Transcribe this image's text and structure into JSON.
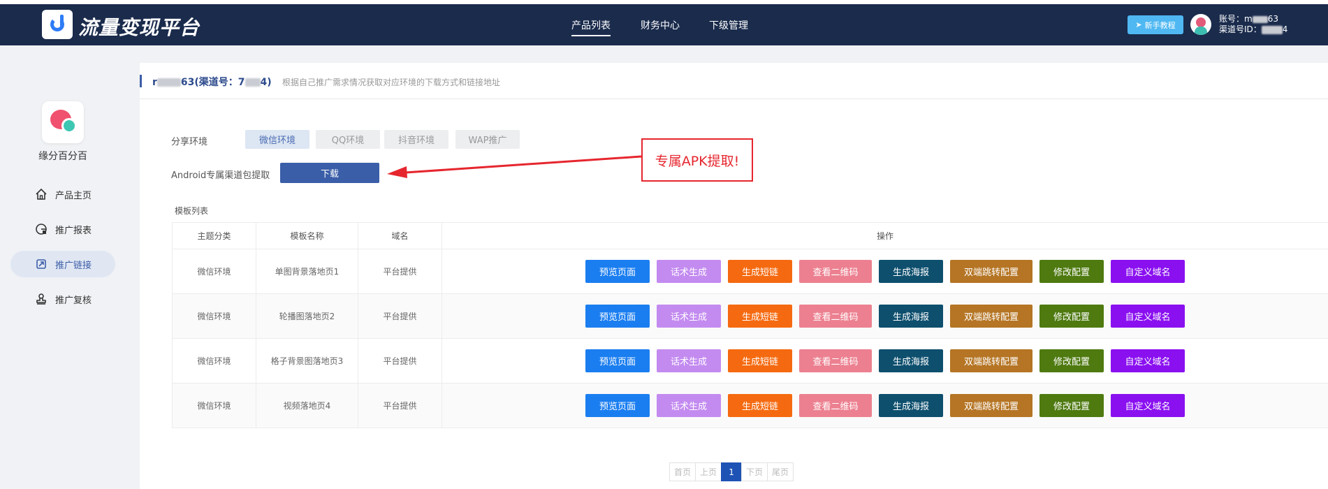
{
  "header": {
    "app_title": "流量变现平台",
    "nav": [
      "产品列表",
      "财务中心",
      "下级管理"
    ],
    "tutorial_label": "新手教程",
    "account_label": "账号：m",
    "account_suffix": "63",
    "channel_label": "渠道号ID：",
    "channel_suffix": "4"
  },
  "sidebar": {
    "app_name": "缘分百分百",
    "items": [
      {
        "label": "产品主页",
        "icon": "home-icon"
      },
      {
        "label": "推广报表",
        "icon": "report-icon"
      },
      {
        "label": "推广链接",
        "icon": "link-icon"
      },
      {
        "label": "推广复核",
        "icon": "stamp-icon"
      }
    ],
    "active_index": 2
  },
  "page": {
    "title_prefix": "r",
    "title_mid": "63(渠道号：7",
    "title_suffix": "4)",
    "description": "根据自己推广需求情况获取对应环境的下载方式和链接地址",
    "share_env_label": "分享环境",
    "env_tabs": [
      "微信环境",
      "QQ环境",
      "抖音环境",
      "WAP推广"
    ],
    "active_env": 0,
    "android_label": "Android专属渠道包提取",
    "download_label": "下载",
    "annotation": "专属APK提取!",
    "list_title": "模板列表"
  },
  "table": {
    "headers": [
      "主题分类",
      "模板名称",
      "域名",
      "操作"
    ],
    "rows": [
      {
        "category": "微信环境",
        "name": "单图背景落地页1",
        "domain": "平台提供"
      },
      {
        "category": "微信环境",
        "name": "轮播图落地页2",
        "domain": "平台提供"
      },
      {
        "category": "微信环境",
        "name": "格子背景图落地页3",
        "domain": "平台提供"
      },
      {
        "category": "微信环境",
        "name": "视频落地页4",
        "domain": "平台提供"
      }
    ],
    "actions": [
      {
        "label": "预览页面",
        "color": "#1b7ef0"
      },
      {
        "label": "话术生成",
        "color": "#c38bf0"
      },
      {
        "label": "生成短链",
        "color": "#f56a10"
      },
      {
        "label": "查看二维码",
        "color": "#ec8090"
      },
      {
        "label": "生成海报",
        "color": "#0e4f6e"
      },
      {
        "label": "双端跳转配置",
        "color": "#b57524"
      },
      {
        "label": "修改配置",
        "color": "#4e7a10"
      },
      {
        "label": "自定义域名",
        "color": "#8a10f0"
      }
    ]
  },
  "pager": {
    "first": "首页",
    "prev": "上页",
    "current": "1",
    "next": "下页",
    "last": "尾页"
  }
}
